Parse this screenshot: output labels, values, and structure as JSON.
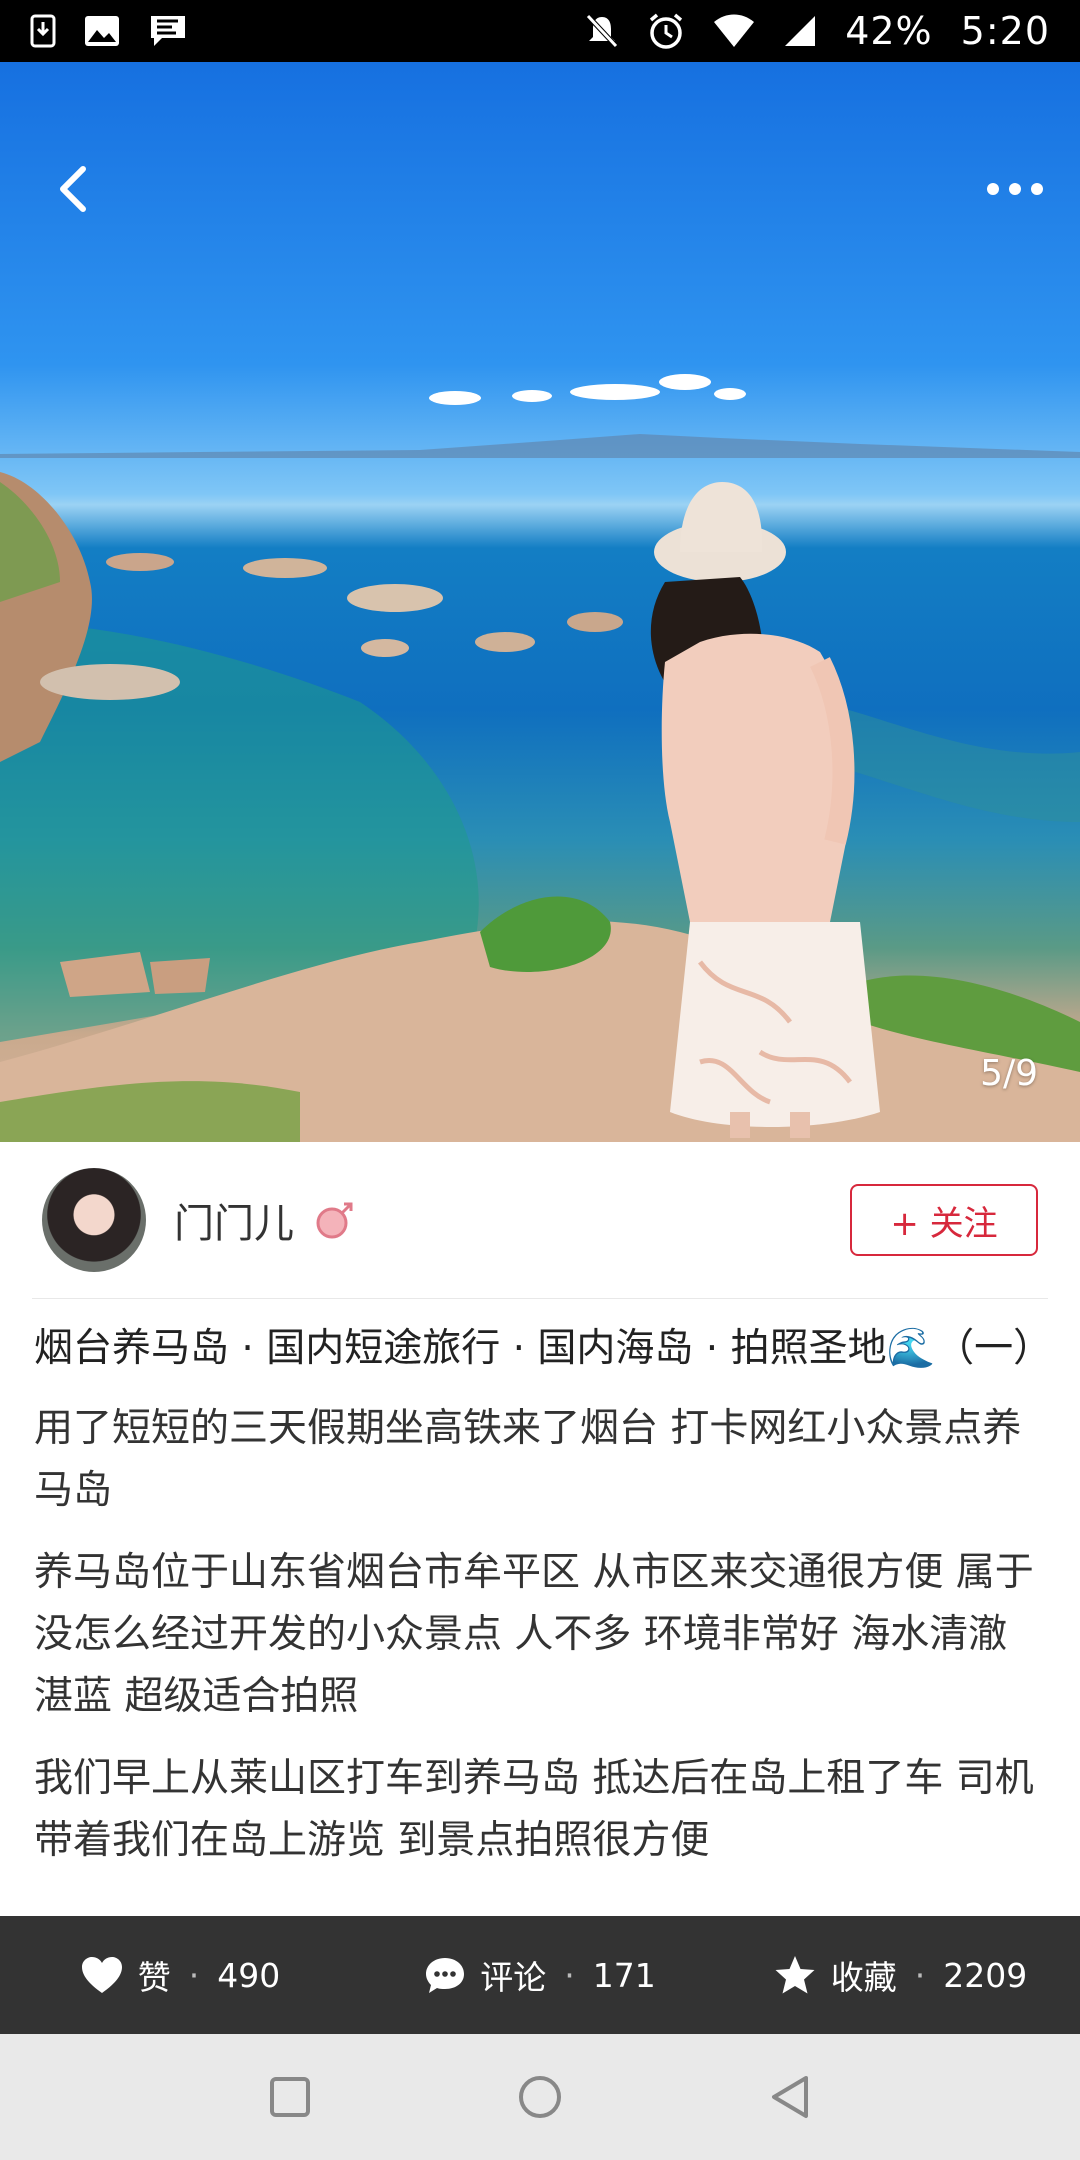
{
  "status_bar": {
    "battery": "42%",
    "time": "5:20",
    "icons_left": [
      "download-icon",
      "image-icon",
      "chat-flag-icon"
    ],
    "icons_right": [
      "mute-icon",
      "alarm-icon",
      "wifi-icon",
      "signal-icon"
    ]
  },
  "hero": {
    "page_indicator": "5/9",
    "back_icon": "chevron-left-icon",
    "more_icon": "more-dots-icon"
  },
  "author": {
    "name": "门门儿",
    "badge_icon": "female-badge-icon",
    "follow_label": "+ 关注"
  },
  "post": {
    "title": "烟台养马岛 · 国内短途旅行 · 国内海岛 · 拍照圣地🌊（一）",
    "paragraphs": [
      "用了短短的三天假期坐高铁来了烟台 打卡网红小众景点养马岛",
      "养马岛位于山东省烟台市牟平区 从市区来交通很方便 属于没怎么经过开发的小众景点 人不多 环境非常好 海水清澈湛蓝 超级适合拍照",
      "我们早上从莱山区打车到养马岛 抵达后在岛上租了车 司机带着我们在岛上游览 到景点拍照很方便"
    ]
  },
  "actions": {
    "like_label": "赞",
    "like_count": "490",
    "comment_label": "评论",
    "comment_count": "171",
    "favorite_label": "收藏",
    "favorite_count": "2209",
    "separator": "·"
  },
  "colors": {
    "accent": "#d7283c",
    "action_bar": "#333333",
    "nav_bar": "#e9e9e9"
  }
}
